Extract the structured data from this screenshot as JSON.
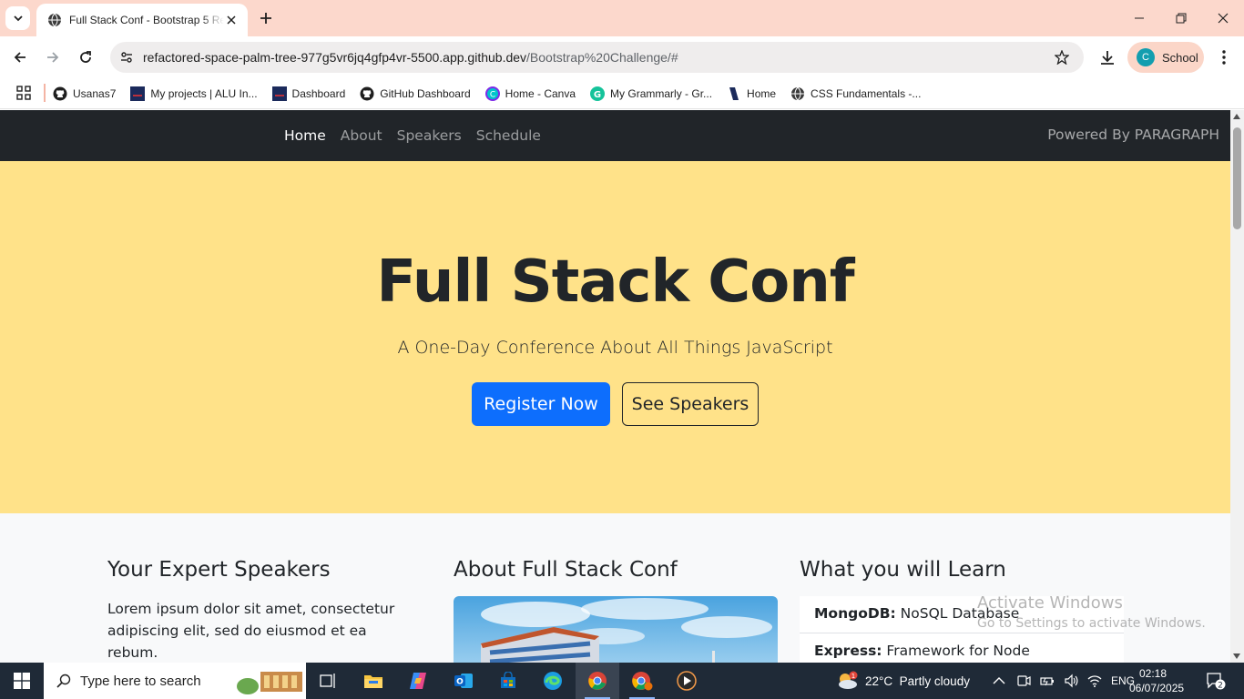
{
  "browser": {
    "tab_title": "Full Stack Conf - Bootstrap 5 Re",
    "url_host": "refactored-space-palm-tree-977g5vr6jq4gfp4vr-5500.app.github.dev",
    "url_path": "/Bootstrap%20Challenge/#",
    "profile_initial": "C",
    "profile_name": "School",
    "tab_color": "#fcd8cc"
  },
  "bookmarks": [
    {
      "label": "Usanas7",
      "icon": "github-icon"
    },
    {
      "label": "My projects | ALU In...",
      "icon": "alu-icon"
    },
    {
      "label": "Dashboard",
      "icon": "alu-icon"
    },
    {
      "label": "GitHub Dashboard",
      "icon": "github-icon"
    },
    {
      "label": "Home - Canva",
      "icon": "canva-icon"
    },
    {
      "label": "My Grammarly - Gr...",
      "icon": "grammarly-icon"
    },
    {
      "label": "Home",
      "icon": "bookmark-icon"
    },
    {
      "label": "CSS Fundamentals -...",
      "icon": "globe-icon"
    }
  ],
  "site": {
    "nav": [
      "Home",
      "About",
      "Speakers",
      "Schedule"
    ],
    "brand": "Powered By PARAGRAPH",
    "hero_title": "Full Stack Conf",
    "hero_lead": "A One-Day Conference About All Things JavaScript",
    "btn_register": "Register Now",
    "btn_speakers": "See Speakers",
    "col1_title": "Your Expert Speakers",
    "col1_text": "Lorem ipsum dolor sit amet, consectetur adipiscing elit, sed do eiusmod et ea rebum.",
    "col2_title": "About Full Stack Conf",
    "col3_title": "What you will Learn",
    "learn": [
      {
        "name": "MongoDB:",
        "desc": " NoSQL Database"
      },
      {
        "name": "Express:",
        "desc": " Framework for Node"
      }
    ],
    "hero_color": "#ffe289",
    "primary_color": "#0d6efd"
  },
  "watermark": {
    "line1": "Activate Windows",
    "line2": "Go to Settings to activate Windows."
  },
  "taskbar": {
    "search_placeholder": "Type here to search",
    "weather": "22°C  Partly cloudy",
    "lang": "ENG",
    "time": "02:18",
    "date": "06/07/2025",
    "notifications": "2",
    "weather_badge": "1"
  }
}
